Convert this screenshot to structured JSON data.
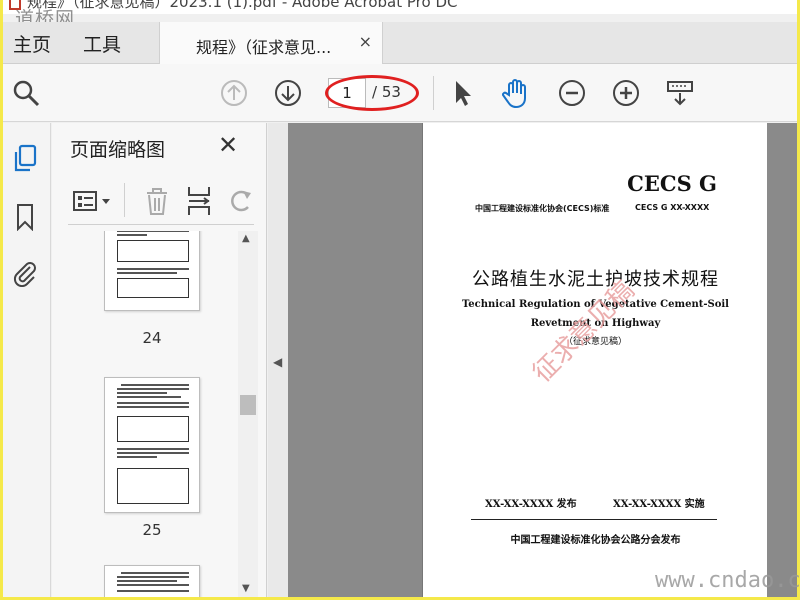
{
  "window": {
    "title": "规程》（征求意见稿）2023.1 (1).pdf - Adobe Acrobat Pro DC"
  },
  "watermarks": {
    "top_left": "道桥网",
    "bottom_right": "www.cndao.c"
  },
  "nav_tabs": {
    "home": "主页",
    "tools": "工具"
  },
  "doc_tab": {
    "label": "规程》（征求意见...",
    "close": "×"
  },
  "toolbar": {
    "page_current": "1",
    "page_total": "/ 53",
    "highlight_color": "#e02020",
    "active_tool": "hand",
    "icons": [
      "search-icon",
      "page-up-icon",
      "page-down-icon",
      "select-arrow-icon",
      "hand-icon",
      "zoom-out-icon",
      "zoom-in-icon",
      "read-mode-icon"
    ]
  },
  "thumbnails_panel": {
    "title": "页面缩略图",
    "close": "✕",
    "thumbnails": [
      {
        "page": "24"
      },
      {
        "page": "25"
      }
    ]
  },
  "document": {
    "series": "CECS G",
    "standard_line": "中国工程建设标准化协会(CECS)标准",
    "standard_code": "CECS G XX-XXXX",
    "title_cn": "公路植生水泥土护坡技术规程",
    "title_en_line1": "Technical Regulation of Vegetative Cement-Soil",
    "title_en_line2": "Revetment on Highway",
    "draft_note": "（征求意见稿）",
    "stamp": "征求意见稿",
    "publish_date": "XX-XX-XXXX 发布",
    "effective_date": "XX-XX-XXXX 实施",
    "publisher": "中国工程建设标准化协会公路分会发布"
  },
  "colors": {
    "frame": "#f5e94a",
    "accent_blue": "#1a73c8",
    "stamp_red": "#e8a0a0"
  }
}
